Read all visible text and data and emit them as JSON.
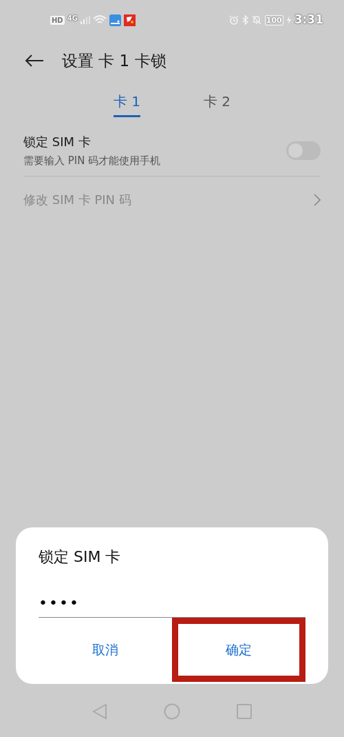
{
  "status_bar": {
    "left": [
      "HD",
      "4G"
    ],
    "battery": "100",
    "time": "3:31"
  },
  "header": {
    "title": "设置 卡 1 卡锁"
  },
  "tabs": [
    {
      "label": "卡 1",
      "selected": true
    },
    {
      "label": "卡 2",
      "selected": false
    }
  ],
  "settings": [
    {
      "kind": "toggle",
      "title": "锁定 SIM 卡",
      "subtitle": "需要输入 PIN 码才能使用手机",
      "on": false
    },
    {
      "kind": "link",
      "title": "修改 SIM 卡 PIN 码",
      "disabled": true
    }
  ],
  "dialog": {
    "title": "锁定 SIM 卡",
    "pin_field": {
      "value": "••••"
    },
    "buttons": [
      {
        "label": "取消",
        "highlighted": false
      },
      {
        "label": "确定",
        "highlighted": true
      }
    ]
  }
}
